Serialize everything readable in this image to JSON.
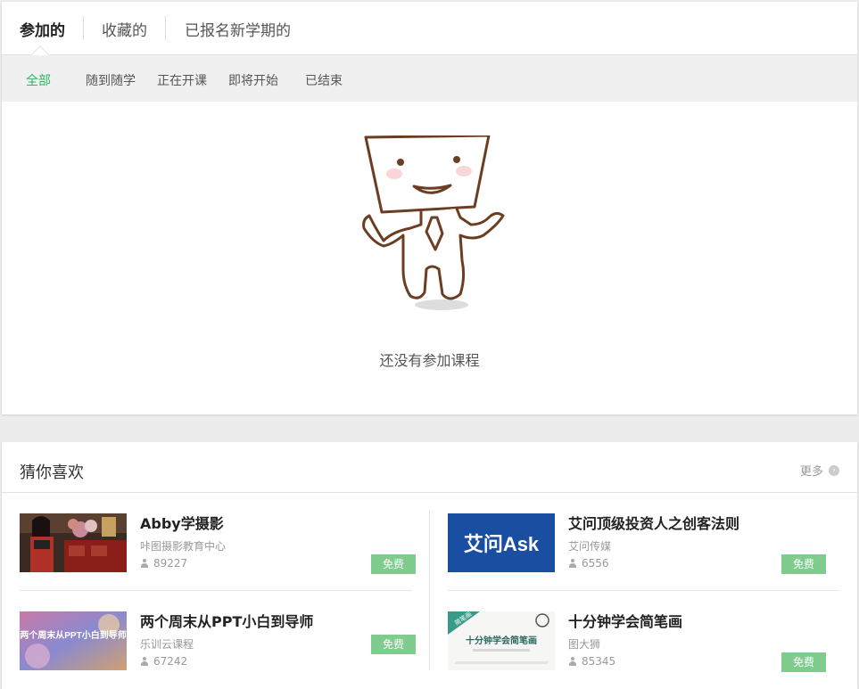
{
  "tabs": [
    {
      "label": "参加的",
      "active": true
    },
    {
      "label": "收藏的",
      "active": false
    },
    {
      "label": "已报名新学期的",
      "active": false
    }
  ],
  "filters": [
    {
      "label": "全部",
      "active": true
    },
    {
      "label": "随到随学",
      "active": false
    },
    {
      "label": "正在开课",
      "active": false
    },
    {
      "label": "即将开始",
      "active": false
    },
    {
      "label": "已结束",
      "active": false
    }
  ],
  "empty": {
    "text": "还没有参加课程"
  },
  "recommend": {
    "title": "猜你喜欢",
    "more": "更多",
    "courses": [
      {
        "title": "Abby学摄影",
        "org": "咔图摄影教育中心",
        "count": "89227",
        "price": "免费"
      },
      {
        "title": "艾问顶级投资人之创客法则",
        "org": "艾问传媒",
        "count": "6556",
        "price": "免费",
        "thumb_text": "艾问Ask"
      },
      {
        "title": "两个周末从PPT小白到导师",
        "org": "乐训云课程",
        "count": "67242",
        "price": "免费",
        "thumb_text": "两个周末从PPT小白到导师"
      },
      {
        "title": "十分钟学会简笔画",
        "org": "图大狮",
        "count": "85345",
        "price": "免费",
        "thumb_text": "十分钟学会简笔画",
        "thumb_badge": "简笔画"
      }
    ]
  },
  "colors": {
    "accent": "#2eb460",
    "free_badge": "#7fcc8e",
    "aiwen_blue": "#1a4ea0"
  }
}
